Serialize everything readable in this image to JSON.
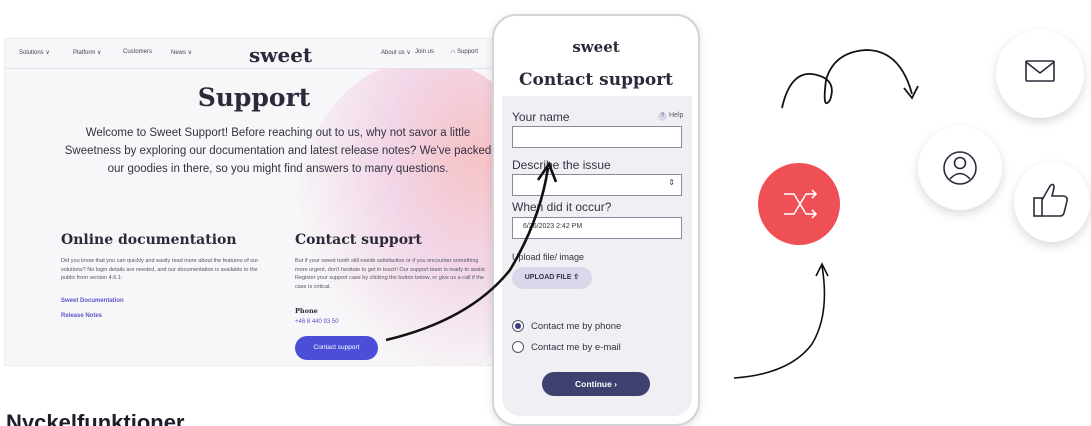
{
  "site": {
    "nav": {
      "solutions": "Solutions ∨",
      "platform": "Platform ∨",
      "customers": "Customers",
      "news": "News ∨",
      "logo": "sweet",
      "about": "About us ∨",
      "join": "Join us",
      "support": "Support"
    },
    "title": "Support",
    "intro": "Welcome to Sweet Support! Before reaching out to us, why not savor a little Sweetness by exploring our documentation and latest release notes? We've packed our goodies in there, so you might find answers to many questions.",
    "docs": {
      "title": "Online documentation",
      "text": "Did you know that you can quickly and easily read more about the features of our solutions? No login details are needed, and our documentation is available to the public from version 4.6.1:",
      "link1": "Sweet Documentation",
      "link2": "Release Notes"
    },
    "contact": {
      "title": "Contact support",
      "text": "But if your sweet tooth still needs satisfaction or if you encounter something more urgent, don't hesitate to get in touch! Our support team is ready to assist. Register your support case by clicking the button below, or give us a call if the case is critical.",
      "phone_label": "Phone",
      "phone_number": "+46 8 440 93 50",
      "button": "Contact support"
    }
  },
  "phone": {
    "logo": "sweet",
    "title": "Contact support",
    "name_label": "Your name",
    "help": "Help",
    "issue_label": "Describe the issue",
    "when_label": "When did it occur?",
    "date_value": "6/26/2023 2:42 PM",
    "upload_label": "Upload file/ image",
    "upload_button": "UPLOAD FILE",
    "radio_phone": "Contact me by phone",
    "radio_email": "Contact me by e-mail",
    "continue": "Continue  ›"
  },
  "bottom_heading": "Nyckelfunktioner",
  "colors": {
    "accent_red": "#ef5055",
    "brand_blue": "#4b4fd8",
    "continue_navy": "#3e4170"
  },
  "icons": [
    "mail-icon",
    "user-icon",
    "thumbs-up-icon",
    "shuffle-icon"
  ]
}
